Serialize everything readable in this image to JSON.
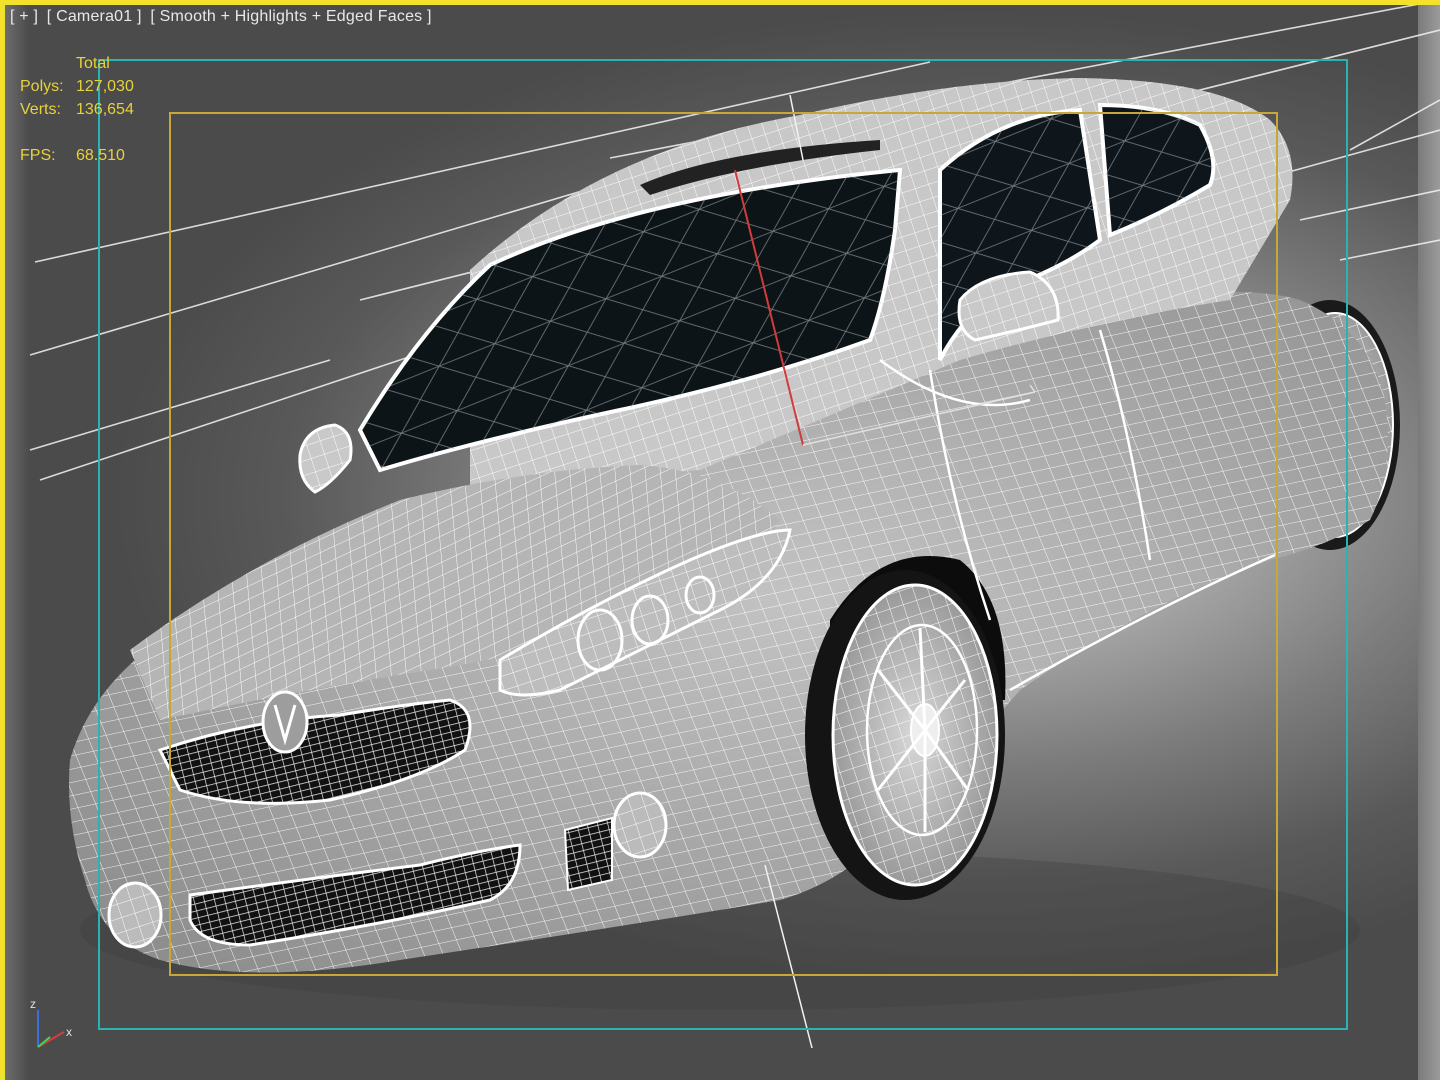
{
  "viewport_label": {
    "plus": "[ + ]",
    "camera": "[ Camera01 ]",
    "shading": "[ Smooth + Highlights + Edged Faces ]"
  },
  "stats": {
    "header": "Total",
    "polys_label": "Polys:",
    "polys_value": "127,030",
    "verts_label": "Verts:",
    "verts_value": "136,654",
    "fps_label": "FPS:",
    "fps_value": "68.510"
  },
  "axis": {
    "z": "z",
    "x": "x"
  },
  "colors": {
    "active_border": "#f2e22c",
    "stats_text": "#e7d23a",
    "safe_frame_outer": "#27b4b4",
    "safe_frame_inner": "#c9a63a"
  }
}
